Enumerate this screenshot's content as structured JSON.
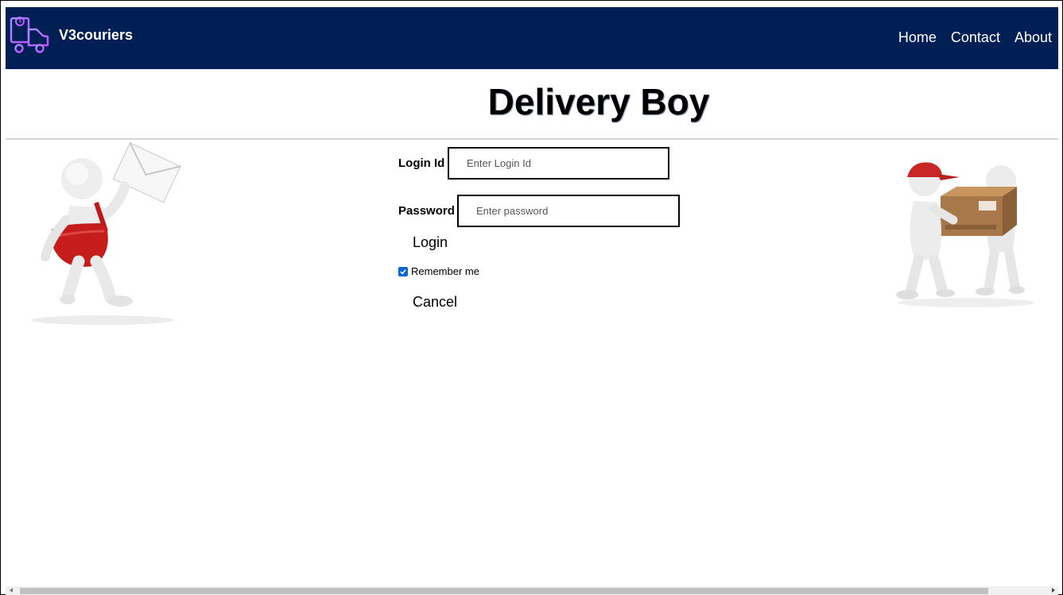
{
  "navbar": {
    "brand_name": "V3couriers",
    "brand_icon": "delivery-truck-icon",
    "links": [
      {
        "label": "Home"
      },
      {
        "label": "Contact"
      },
      {
        "label": "About"
      }
    ],
    "background": "#001f54"
  },
  "page": {
    "title": "Delivery Boy"
  },
  "form": {
    "login_id_label": "Login Id",
    "login_id_placeholder": "Enter Login Id",
    "password_label": "Password",
    "password_placeholder": "Enter password",
    "login_button": "Login",
    "remember_label": "Remember me",
    "remember_checked": true,
    "cancel_button": "Cancel"
  },
  "illustrations": {
    "left": "mail-carrier-figure",
    "right": "package-carriers-figure"
  },
  "colors": {
    "accent": "#0a66d8",
    "cap_red": "#d42d2d"
  }
}
